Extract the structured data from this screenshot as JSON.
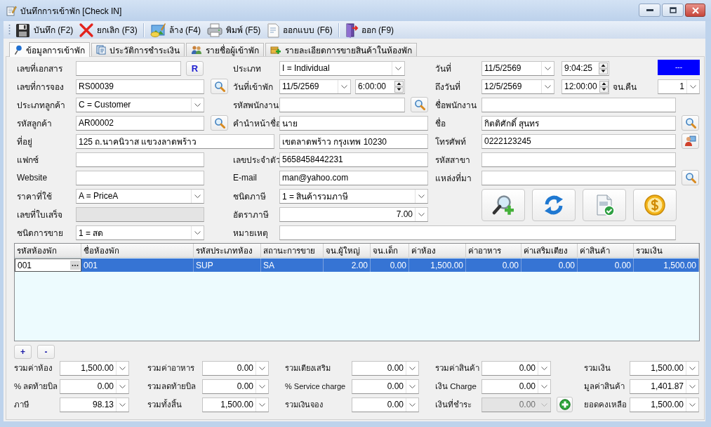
{
  "window": {
    "title": "บันทึกการเข้าพัก [Check IN]"
  },
  "toolbar": [
    "บันทึก (F2)",
    "ยกเลิก (F3)",
    "ล้าง (F4)",
    "พิมพ์ (F5)",
    "ออกแบบ (F6)",
    "ออก (F9)"
  ],
  "tabs": [
    {
      "label": "ข้อมูลการเข้าพัก",
      "selected": true
    },
    {
      "label": "ประวัติการชำระเงิน",
      "selected": false
    },
    {
      "label": "รายชื่อผู้เข้าพัก",
      "selected": false
    },
    {
      "label": "รายละเอียดการขายสินค้าในห้องพัก",
      "selected": false
    }
  ],
  "form": {
    "document_no": {
      "label": "เลขที่เอกสาร"
    },
    "reload_button": "R",
    "type": {
      "label": "ประเภท",
      "value": "I = Individual"
    },
    "date": {
      "label": "วันที่",
      "date": "11/5/2569",
      "time": "9:04:25"
    },
    "status": "---",
    "booking_no": {
      "label": "เลขที่การจอง",
      "value": "RS00039"
    },
    "check_in": {
      "label": "วันที่เข้าพัก",
      "date": "11/5/2569",
      "time": "6:00:00"
    },
    "to_date": {
      "label": "ถึงวันที่",
      "date": "12/5/2569",
      "time": "12:00:00"
    },
    "nights": {
      "label": "จน.คืน",
      "value": "1"
    },
    "customer_type": {
      "label": "ประเภทลูกค้า",
      "value": "C = Customer"
    },
    "employee_code": {
      "label": "รหัสพนักงาน"
    },
    "employee_name": {
      "label": "ชื่อพนักงาน"
    },
    "customer_code": {
      "label": "รหัสลูกค้า",
      "value": "AR00002"
    },
    "title": {
      "label": "คำนำหน้าชื่อ",
      "value": "นาย"
    },
    "name": {
      "label": "ชื่อ",
      "value": "กิตติศักดิ์ สุนทร"
    },
    "address": {
      "label": "ที่อยู่",
      "line_1": "125 ถ.นาคนิวาส แขวงลาดพร้าว",
      "line_2": "เขตลาดพร้าว กรุงเทพ 10230"
    },
    "phone": {
      "label": "โทรศัพท์",
      "value": "0222123245"
    },
    "fax": {
      "label": "แฟกซ์"
    },
    "id_no": {
      "label": "เลขประจำตัว",
      "value": "5658458442231"
    },
    "branch_code": {
      "label": "รหัสสาขา"
    },
    "website": {
      "label": "Website"
    },
    "email": {
      "label": "E-mail",
      "value": "man@yahoo.com"
    },
    "source": {
      "label": "แหล่งที่มา"
    },
    "price_level": {
      "label": "ราคาที่ใช้",
      "value": "A = PriceA"
    },
    "tax_type": {
      "label": "ชนิดภาษี",
      "value": "1 = สินค้ารวมภาษี"
    },
    "receipt_no": {
      "label": "เลขที่ใบเสร็จ",
      "disabled": true
    },
    "tax_rate": {
      "label": "อัตราภาษี",
      "value": "7.00"
    },
    "sale_type": {
      "label": "ชนิดการขาย",
      "value": "1 = สด"
    },
    "note": {
      "label": "หมายเหตุ"
    }
  },
  "table": {
    "columns": [
      {
        "label": "รหัสห้องพัก",
        "kind": "text"
      },
      {
        "label": "ชื่อห้องพัก",
        "kind": "text"
      },
      {
        "label": "รหัสประเภทห้อง",
        "kind": "text"
      },
      {
        "label": "สถานะการขาย",
        "kind": "text"
      },
      {
        "label": "จน.ผู้ใหญ่",
        "kind": "number"
      },
      {
        "label": "จน.เด็ก",
        "kind": "number"
      },
      {
        "label": "ค่าห้อง",
        "kind": "number"
      },
      {
        "label": "ค่าอาหาร",
        "kind": "number"
      },
      {
        "label": "ค่าเสริมเตียง",
        "kind": "number"
      },
      {
        "label": "ค่าสินค้า",
        "kind": "number"
      },
      {
        "label": "รวมเงิน",
        "kind": "number"
      }
    ],
    "rows": [
      {
        "selected": true,
        "cells": [
          "001",
          "001",
          "SUP",
          "SA",
          "2.00",
          "0.00",
          "1,500.00",
          "0.00",
          "0.00",
          "0.00",
          "1,500.00"
        ]
      }
    ]
  },
  "row_buttons": [
    "+",
    "-"
  ],
  "totals": [
    {
      "label": "รวมค่าห้อง",
      "value": "1,500.00",
      "disabled": false
    },
    {
      "label": "รวมค่าอาหาร",
      "value": "0.00",
      "disabled": false
    },
    {
      "label": "รวมเตียงเสริม",
      "value": "0.00",
      "disabled": false
    },
    {
      "label": "รวมค่าสินค้า",
      "value": "0.00",
      "disabled": false
    },
    {
      "label": "รวมเงิน",
      "value": "1,500.00",
      "disabled": false
    },
    {
      "label": "% ลดท้ายบิล",
      "value": "0.00",
      "disabled": false
    },
    {
      "label": "รวมลดท้ายบิล",
      "value": "0.00",
      "disabled": false
    },
    {
      "label": "% Service charge",
      "value": "0.00",
      "disabled": false
    },
    {
      "label": "เงิน Charge",
      "value": "0.00",
      "disabled": false
    },
    {
      "label": "มูลค่าสินค้า",
      "value": "1,401.87",
      "disabled": false
    },
    {
      "label": "ภาษี",
      "value": "98.13",
      "disabled": false
    },
    {
      "label": "รวมทั้งสิ้น",
      "value": "1,500.00",
      "disabled": false
    },
    {
      "label": "รวมเงินจอง",
      "value": "0.00",
      "disabled": false
    },
    {
      "label": "เงินที่ชำระ",
      "value": "0.00",
      "disabled": true
    },
    {
      "label": "ยอดคงเหลือ",
      "value": "1,500.00",
      "disabled": false
    }
  ]
}
